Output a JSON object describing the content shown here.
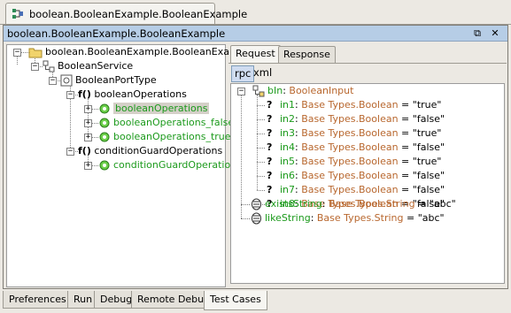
{
  "document_tab": {
    "label": "boolean.BooleanExample.BooleanExample",
    "icon": "service-grid-icon"
  },
  "window": {
    "title": "boolean.BooleanExample.BooleanExample",
    "restore_glyph": "⧉",
    "close_glyph": "✕"
  },
  "service_tree": {
    "root": "boolean.BooleanExample.BooleanExample",
    "service": "BooleanService",
    "port_type": "BooleanPortType",
    "groups": [
      {
        "label": "booleanOperations",
        "prefix": "f()",
        "children": [
          "booleanOperations",
          "booleanOperations_false",
          "booleanOperations_true"
        ]
      },
      {
        "label": "conditionGuardOperations",
        "prefix": "f()",
        "children": [
          "conditionGuardOperations"
        ]
      }
    ]
  },
  "request_panel": {
    "tabs": [
      "Request",
      "Response"
    ],
    "active_tab": "Request",
    "subtabs": [
      "rpc",
      "xml"
    ],
    "active_subtab": "rpc",
    "root": {
      "name": "bIn",
      "sep": ": ",
      "type": "BooleanInput"
    },
    "params": [
      {
        "name": "in1",
        "type": "Base Types.Boolean",
        "eq": " = ",
        "value": "\"true\""
      },
      {
        "name": "in2",
        "type": "Base Types.Boolean",
        "eq": " = ",
        "value": "\"false\""
      },
      {
        "name": "in3",
        "type": "Base Types.Boolean",
        "eq": " = ",
        "value": "\"true\""
      },
      {
        "name": "in4",
        "type": "Base Types.Boolean",
        "eq": " = ",
        "value": "\"false\""
      },
      {
        "name": "in5",
        "type": "Base Types.Boolean",
        "eq": " = ",
        "value": "\"true\""
      },
      {
        "name": "in6",
        "type": "Base Types.Boolean",
        "eq": " = ",
        "value": "\"false\""
      },
      {
        "name": "in7",
        "type": "Base Types.Boolean",
        "eq": " = ",
        "value": "\"false\""
      },
      {
        "name": "in8",
        "type": "Base Types.Boolean",
        "eq": " = ",
        "value": "\"false\""
      }
    ],
    "strings": [
      {
        "name": "existsString",
        "type": "Base Types.String",
        "eq": " = ",
        "value": "\"abc\""
      },
      {
        "name": "likeString",
        "type": "Base Types.String",
        "eq": " = ",
        "value": "\"abc\""
      }
    ]
  },
  "bottom_tabs": [
    "Preferences",
    "Run",
    "Debug",
    "Remote Debug",
    "Test Cases"
  ],
  "active_bottom_tab": "Test Cases",
  "colors": {
    "green": "#1c9a1c",
    "orange": "#b8672e",
    "titlebar": "#b6cde6"
  }
}
